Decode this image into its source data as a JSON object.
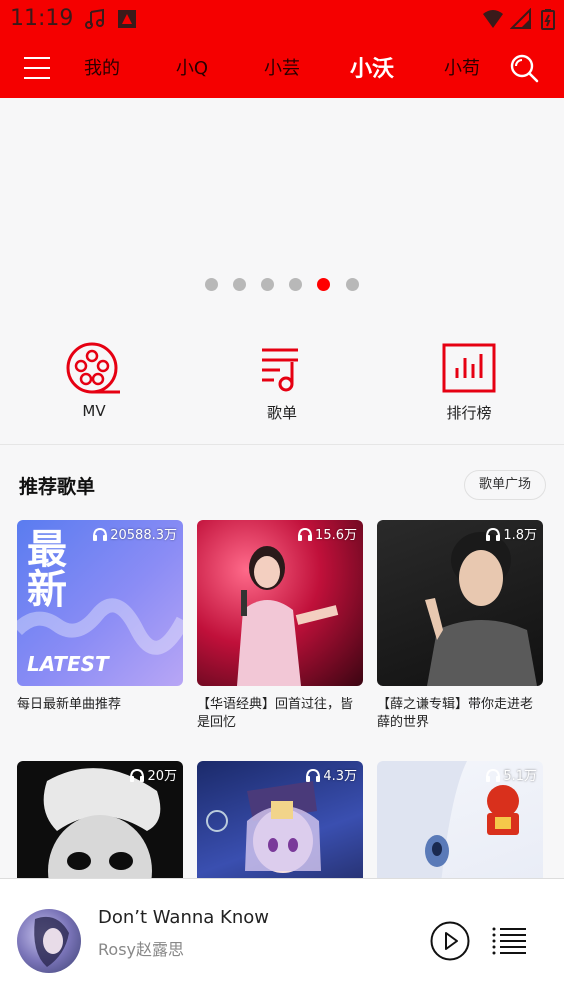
{
  "status": {
    "time": "11:19"
  },
  "nav": {
    "tabs": [
      {
        "label": "我的"
      },
      {
        "label": "小Q"
      },
      {
        "label": "小芸"
      },
      {
        "label": "小沃"
      },
      {
        "label": "小苟"
      }
    ],
    "active_tab": "小沃"
  },
  "banner": {
    "page_count": 6,
    "active_index": 4
  },
  "quick_actions": [
    {
      "label": "MV",
      "icon": "film-reel-icon"
    },
    {
      "label": "歌单",
      "icon": "playlist-icon"
    },
    {
      "label": "排行榜",
      "icon": "chart-icon"
    }
  ],
  "recommend": {
    "title": "推荐歌单",
    "more_label": "歌单广场",
    "playlists": [
      {
        "plays": "20588.3万",
        "title": "每日最新单曲推荐",
        "cover_text_1": "最",
        "cover_text_2": "新",
        "cover_text_3": "LATEST"
      },
      {
        "plays": "15.6万",
        "title": "【华语经典】回首过往，皆是回忆"
      },
      {
        "plays": "1.8万",
        "title": "【薛之谦专辑】带你走进老薛的世界"
      },
      {
        "plays": "20万",
        "title": ""
      },
      {
        "plays": "4.3万",
        "title": ""
      },
      {
        "plays": "5.1万",
        "title": ""
      }
    ]
  },
  "player": {
    "song": "Don’t Wanna Know",
    "artist": "Rosy赵露思"
  },
  "colors": {
    "brand": "#f50000",
    "accent": "#e60012"
  }
}
